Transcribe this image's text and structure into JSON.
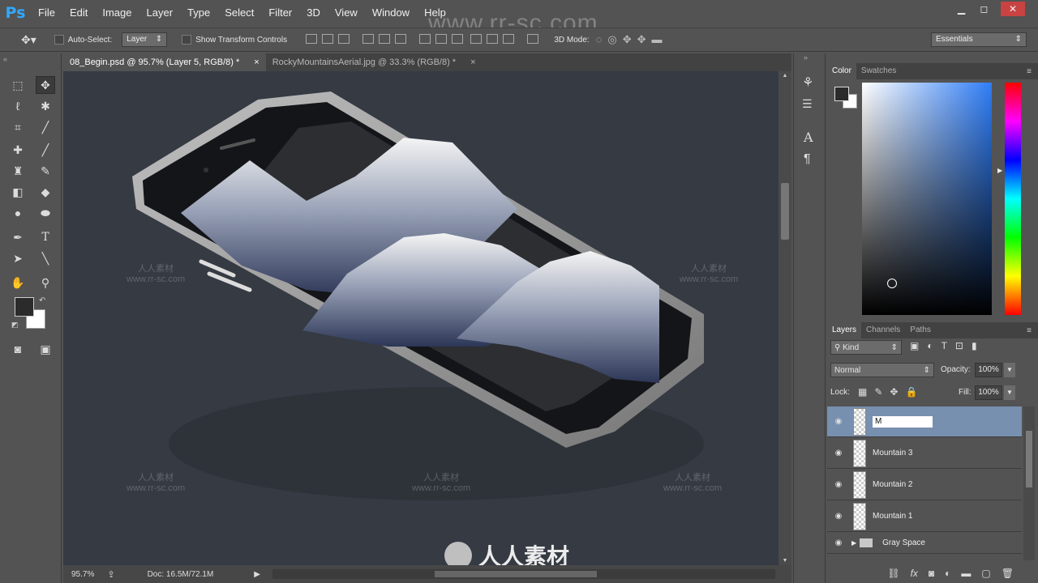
{
  "app": {
    "logo": "Ps",
    "watermark": "www.rr-sc.com"
  },
  "menu": [
    "File",
    "Edit",
    "Image",
    "Layer",
    "Type",
    "Select",
    "Filter",
    "3D",
    "View",
    "Window",
    "Help"
  ],
  "window_controls": {
    "minimize": "▁",
    "restore": "◻",
    "close": "✕"
  },
  "options": {
    "auto_select_label": "Auto-Select:",
    "auto_select_value": "Layer",
    "transform_label": "Show Transform Controls",
    "mode_3d_label": "3D Mode:",
    "workspace": "Essentials"
  },
  "doc_tabs": [
    {
      "label": "08_Begin.psd @ 95.7% (Layer 5, RGB/8) *",
      "close": "×"
    },
    {
      "label": "RockyMountainsAerial.jpg @ 33.3% (RGB/8) *",
      "close": "×"
    }
  ],
  "status": {
    "zoom": "95.7%",
    "doc": "Doc: 16.5M/72.1M"
  },
  "color_panel": {
    "tabs": [
      "Color",
      "Swatches"
    ],
    "fg": "#2b2b2b",
    "bg": "#ffffff"
  },
  "layers_panel": {
    "tabs": [
      "Layers",
      "Channels",
      "Paths"
    ],
    "filter_kind": "Kind",
    "blend_mode": "Normal",
    "opacity_label": "Opacity:",
    "opacity_value": "100%",
    "lock_label": "Lock:",
    "fill_label": "Fill:",
    "fill_value": "100%",
    "editing_name": "M",
    "layers": [
      "Mountain 3",
      "Mountain 2",
      "Mountain 1"
    ],
    "group": "Gray Space"
  },
  "canvas_watermarks": {
    "cn": "人人素材",
    "url": "www.rr-sc.com",
    "bottom_brand": "人人素材"
  }
}
